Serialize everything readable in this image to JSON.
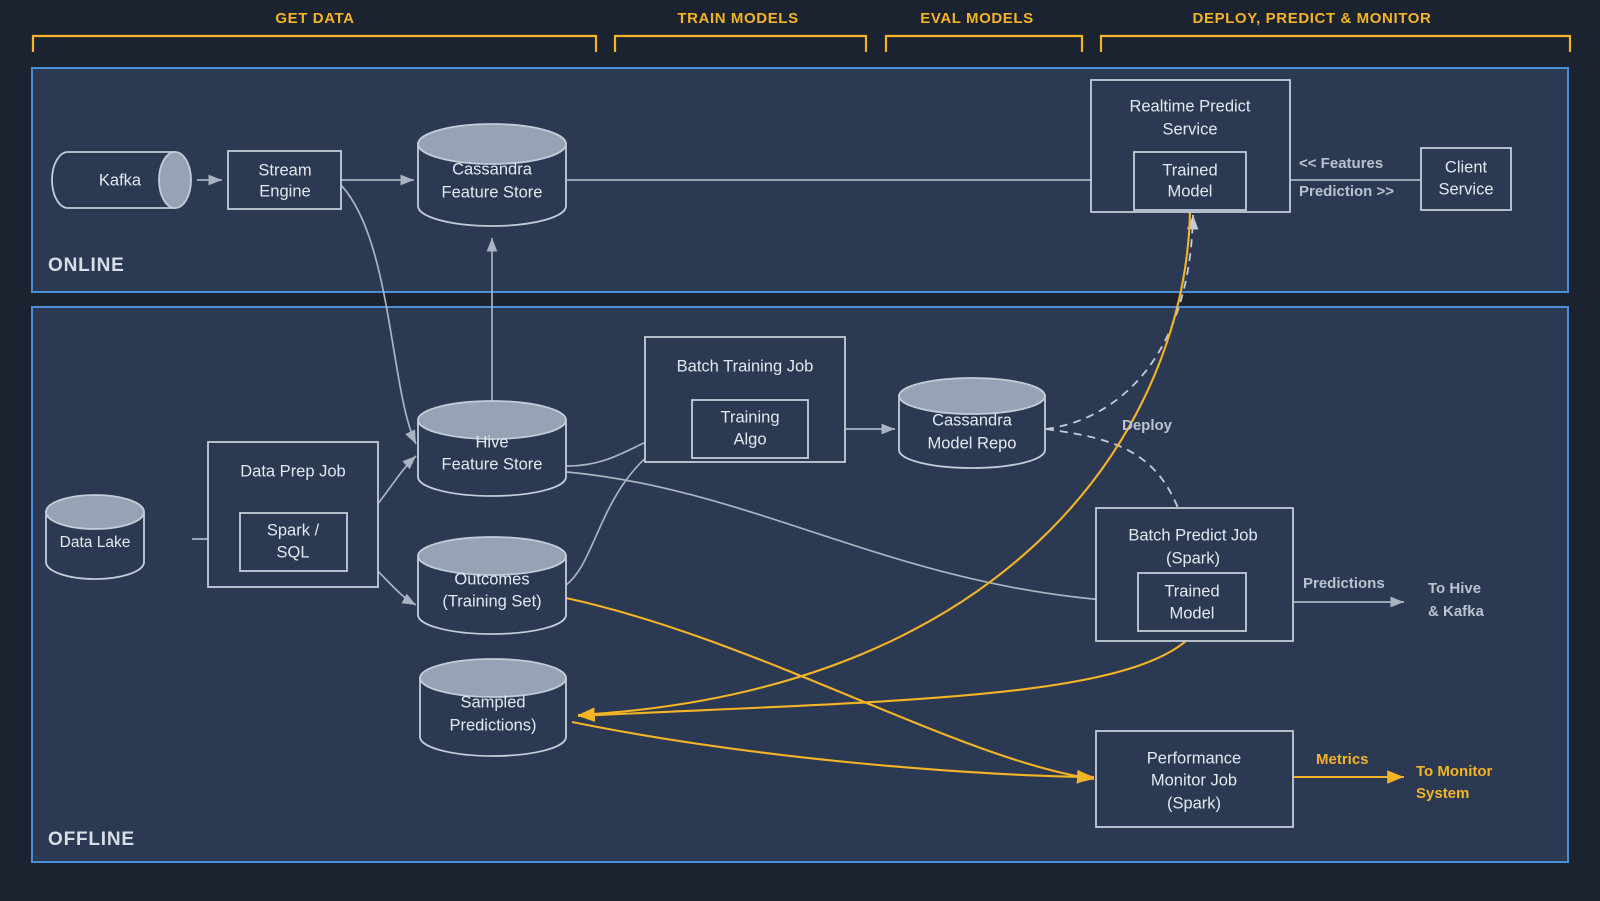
{
  "colors": {
    "page_background": "#1b2230",
    "panel_background": "#2b3a52",
    "panel_border": "#4a90d9",
    "accent_orange": "#f5b326",
    "node_stroke": "#c3ccd8",
    "edge_gray": "#a9b3c1",
    "cylinder_top": "#97a3b4",
    "text_light": "#e3e8ee"
  },
  "phases": [
    {
      "id": "get-data",
      "label": "GET DATA"
    },
    {
      "id": "train-models",
      "label": "TRAIN MODELS"
    },
    {
      "id": "eval-models",
      "label": "EVAL MODELS"
    },
    {
      "id": "deploy-predict-monitor",
      "label": "DEPLOY, PREDICT & MONITOR"
    }
  ],
  "panels": [
    {
      "id": "online",
      "label": "ONLINE"
    },
    {
      "id": "offline",
      "label": "OFFLINE"
    }
  ],
  "nodes": {
    "kafka": {
      "label": "Kafka",
      "shape": "cylinder-horizontal"
    },
    "stream_engine": {
      "line1": "Stream",
      "line2": "Engine",
      "shape": "box"
    },
    "cassandra_feature_store": {
      "line1": "Cassandra",
      "line2": "Feature Store",
      "shape": "cylinder"
    },
    "realtime_predict_service": {
      "line1": "Realtime Predict",
      "line2": "Service",
      "shape": "box"
    },
    "realtime_trained_model": {
      "line1": "Trained",
      "line2": "Model",
      "shape": "box"
    },
    "client_service": {
      "line1": "Client",
      "line2": "Service",
      "shape": "box"
    },
    "data_lake": {
      "label": "Data Lake",
      "shape": "cylinder"
    },
    "data_prep_job": {
      "label": "Data Prep Job",
      "shape": "box"
    },
    "spark_sql": {
      "line1": "Spark /",
      "line2": "SQL",
      "shape": "box"
    },
    "hive_feature_store": {
      "line1": "Hive",
      "line2": "Feature Store",
      "shape": "cylinder"
    },
    "outcomes": {
      "line1": "Outcomes",
      "line2": "(Training Set)",
      "shape": "cylinder"
    },
    "sampled_predictions": {
      "line1": "Sampled",
      "line2": "Predictions)",
      "shape": "cylinder"
    },
    "batch_training_job": {
      "label": "Batch Training Job",
      "shape": "box"
    },
    "training_algo": {
      "line1": "Training",
      "line2": "Algo",
      "shape": "box"
    },
    "cassandra_model_repo": {
      "line1": "Cassandra",
      "line2": "Model Repo",
      "shape": "cylinder"
    },
    "batch_predict_job": {
      "line1": "Batch Predict Job",
      "line2": "(Spark)",
      "shape": "box"
    },
    "batch_trained_model": {
      "line1": "Trained",
      "line2": "Model",
      "shape": "box"
    },
    "performance_monitor_job": {
      "line1": "Performance",
      "line2": "Monitor Job",
      "line3": "(Spark)",
      "shape": "box"
    }
  },
  "edge_labels": {
    "features": "<< Features",
    "prediction": "Prediction >>",
    "deploy": "Deploy",
    "predictions": "Predictions",
    "to_hive_kafka_line1": "To Hive",
    "to_hive_kafka_line2": "& Kafka",
    "metrics": "Metrics",
    "to_monitor_line1": "To Monitor",
    "to_monitor_line2": "System"
  }
}
